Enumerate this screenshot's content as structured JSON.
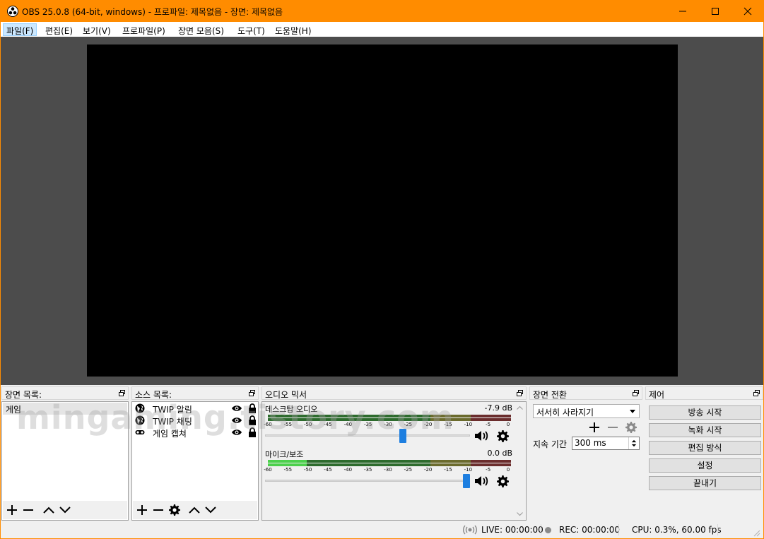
{
  "window": {
    "title": "OBS 25.0.8 (64-bit, windows) - 프로파일: 제목없음 - 장면: 제목없음",
    "accent_color": "#ff8c00"
  },
  "menu": [
    {
      "label": "파일(F)"
    },
    {
      "label": "편집(E)"
    },
    {
      "label": "보기(V)"
    },
    {
      "label": "프로파일(P)"
    },
    {
      "label": "장면 모음(S)"
    },
    {
      "label": "도구(T)"
    },
    {
      "label": "도움말(H)"
    }
  ],
  "scenes": {
    "header": "장면 목록:",
    "items": [
      {
        "label": "게임"
      }
    ]
  },
  "sources": {
    "header": "소스 목록:",
    "items": [
      {
        "label": "TWIP 알림",
        "icon": "globe-icon"
      },
      {
        "label": "TWIP 채팅",
        "icon": "globe-icon"
      },
      {
        "label": "게임 캡쳐",
        "icon": "gamepad-icon"
      }
    ]
  },
  "mixer": {
    "header": "오디오 믹서",
    "ticks": [
      "-60",
      "-55",
      "-50",
      "-45",
      "-40",
      "-35",
      "-30",
      "-25",
      "-20",
      "-15",
      "-10",
      "-5",
      "0"
    ],
    "channels": [
      {
        "name": "데스크탑 오디오",
        "db": "-7.9 dB",
        "volume_fraction": 0.68
      },
      {
        "name": "마이크/보조",
        "db": "0.0 dB",
        "volume_fraction": 1.0
      }
    ]
  },
  "transitions": {
    "header": "장면 전환",
    "selected": "서서히 사라지기",
    "duration_label": "지속 기간",
    "duration_value": "300 ms"
  },
  "controls": {
    "header": "제어",
    "buttons": [
      {
        "label": "방송 시작"
      },
      {
        "label": "녹화 시작"
      },
      {
        "label": "편집 방식"
      },
      {
        "label": "설정"
      },
      {
        "label": "끝내기"
      }
    ]
  },
  "status": {
    "live": "LIVE: 00:00:00",
    "rec": "REC: 00:00:00",
    "cpu": "CPU: 0.3%, 60.00 fps"
  },
  "watermark": "mingaming.tistory.com"
}
